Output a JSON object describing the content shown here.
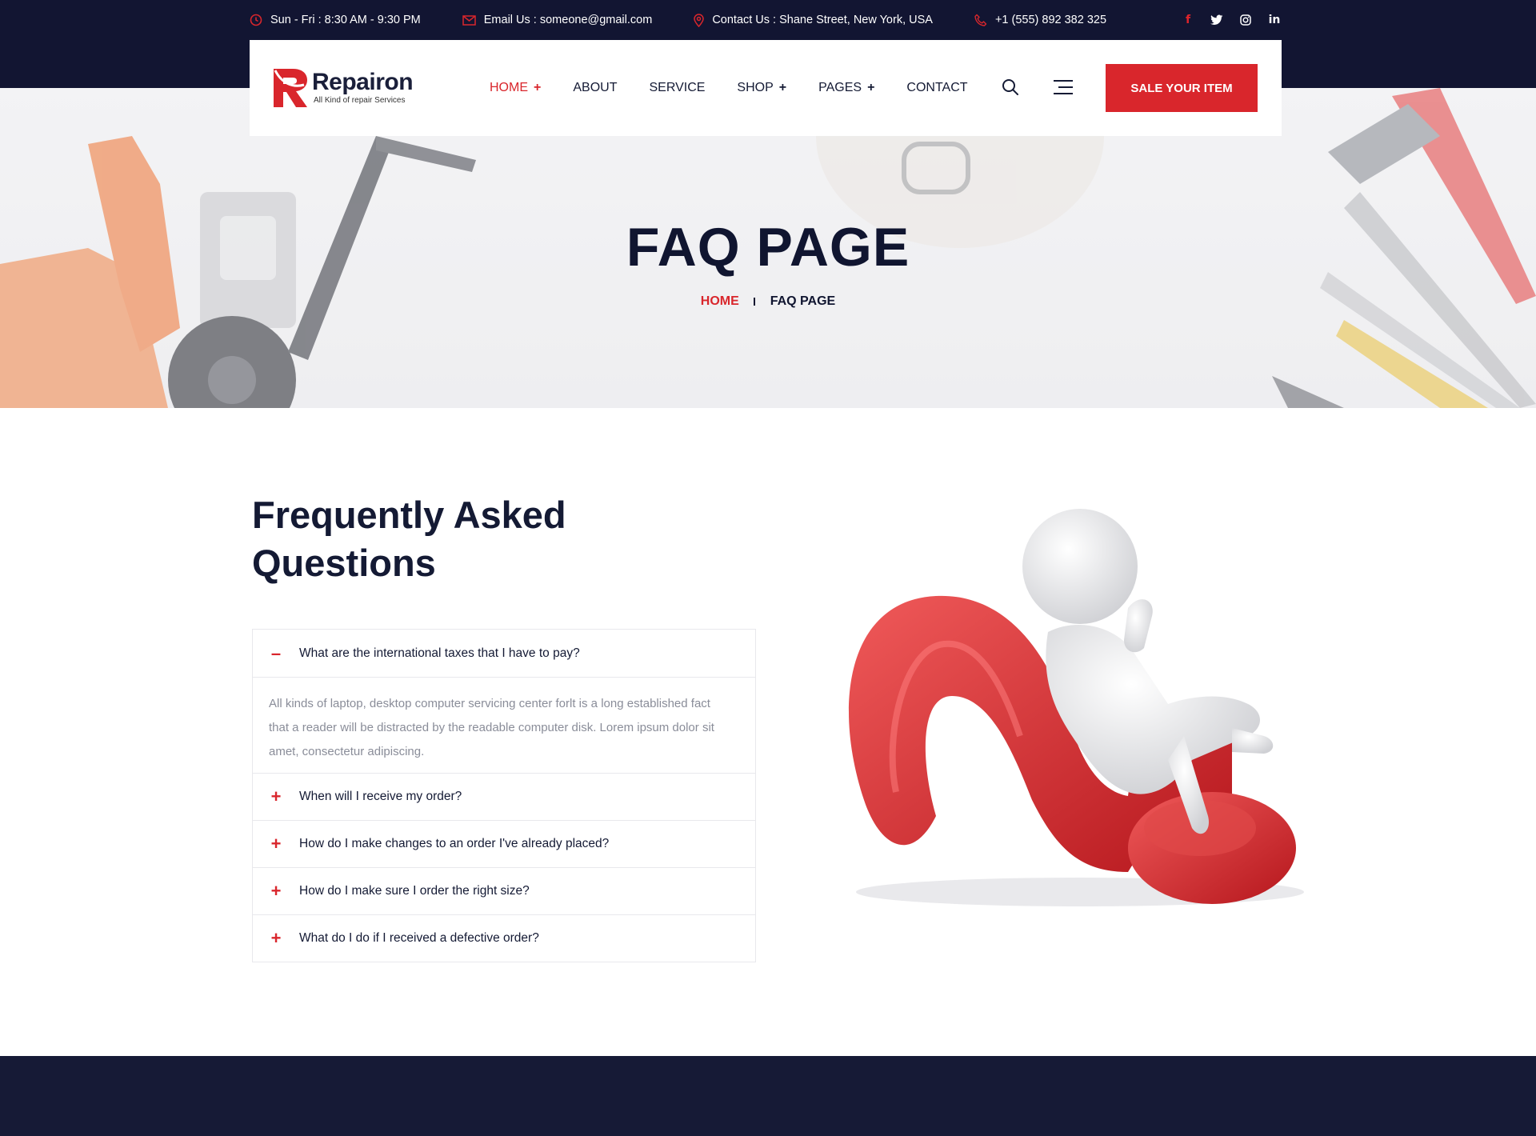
{
  "topbar": {
    "hours": "Sun - Fri : 8:30 AM - 9:30 PM",
    "email": "Email Us : someone@gmail.com",
    "address": "Contact Us : Shane Street, New York, USA",
    "phone": "+1 (555) 892 382 325",
    "social": [
      "facebook-icon",
      "twitter-icon",
      "instagram-icon",
      "linkedin-icon"
    ]
  },
  "brand": {
    "name": "Repairon",
    "tagline": "All Kind of repair Services"
  },
  "nav": {
    "items": [
      {
        "label": "HOME",
        "has_sub": true,
        "active": true
      },
      {
        "label": "ABOUT",
        "has_sub": false,
        "active": false
      },
      {
        "label": "SERVICE",
        "has_sub": false,
        "active": false
      },
      {
        "label": "SHOP",
        "has_sub": true,
        "active": false
      },
      {
        "label": "PAGES",
        "has_sub": true,
        "active": false
      },
      {
        "label": "CONTACT",
        "has_sub": false,
        "active": false
      }
    ],
    "plus": "+",
    "cta": "SALE YOUR ITEM"
  },
  "hero": {
    "title": "FAQ PAGE",
    "breadcrumb_home": "HOME",
    "breadcrumb_current": "FAQ PAGE"
  },
  "faq": {
    "heading_line1": "Frequently Asked",
    "heading_line2": "Questions",
    "items": [
      {
        "question": "What are the international taxes that I have to pay?",
        "open": true,
        "sign": "–"
      },
      {
        "question": "When will I receive my order?",
        "open": false,
        "sign": "+"
      },
      {
        "question": "How do I make changes to an order I've already placed?",
        "open": false,
        "sign": "+"
      },
      {
        "question": "How do I make sure I order the right size?",
        "open": false,
        "sign": "+"
      },
      {
        "question": "What do I do if I received a defective order?",
        "open": false,
        "sign": "+"
      }
    ],
    "answer": "All kinds of laptop, desktop computer servicing center forlt is a long established fact that a reader will be distracted by the readable computer disk. Lorem ipsum dolor sit amet, consectetur adipiscing."
  },
  "colors": {
    "accent": "#d9262c",
    "dark": "#121532",
    "text": "#141a34",
    "muted": "#8a8d99"
  }
}
